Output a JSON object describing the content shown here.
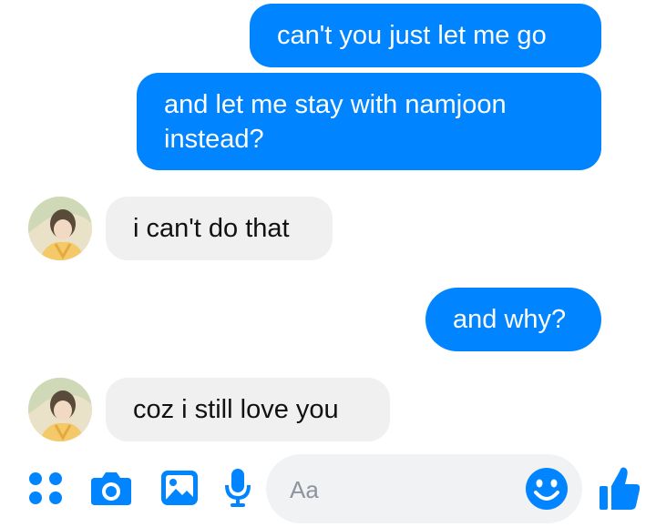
{
  "conversation": {
    "messages": [
      {
        "sender": "me",
        "text": "can't you just let me go"
      },
      {
        "sender": "me",
        "text": "and let me stay with namjoon instead?"
      },
      {
        "sender": "them",
        "text": "i can't do that"
      },
      {
        "sender": "me",
        "text": "and why?"
      },
      {
        "sender": "them",
        "text": "coz i still love you"
      }
    ]
  },
  "composer": {
    "placeholder": "Aa",
    "icons": [
      "more-icon",
      "camera-icon",
      "gallery-icon",
      "microphone-icon",
      "emoji-icon",
      "like-icon"
    ]
  },
  "colors": {
    "outgoing_bubble": "#0084ff",
    "incoming_bubble": "#f1f0f0",
    "accent": "#0084ff"
  }
}
